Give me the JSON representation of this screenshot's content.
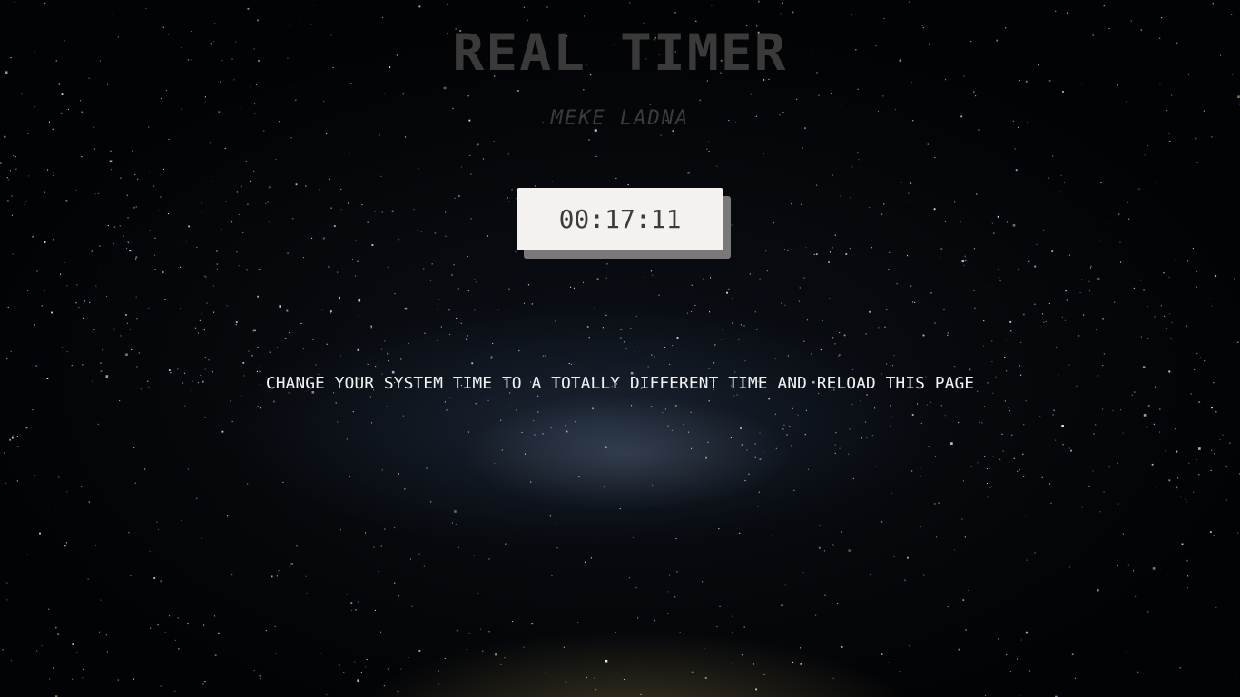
{
  "page": {
    "title": "REAL TIMER",
    "author": "MEKE LADNA",
    "clock_display": "00:17:11",
    "instruction": "CHANGE YOUR SYSTEM TIME TO A TOTALLY DIFFERENT TIME AND RELOAD THIS PAGE"
  },
  "colors": {
    "title": "#3a3a3a",
    "author": "#3b3b3b",
    "clock_background": "#f4f1ef",
    "clock_shadow": "#7a7878",
    "clock_text": "#3c3c3c",
    "instruction_text": "#f2f2f2",
    "background": "#000000"
  },
  "background_image": "starry-night-sky"
}
